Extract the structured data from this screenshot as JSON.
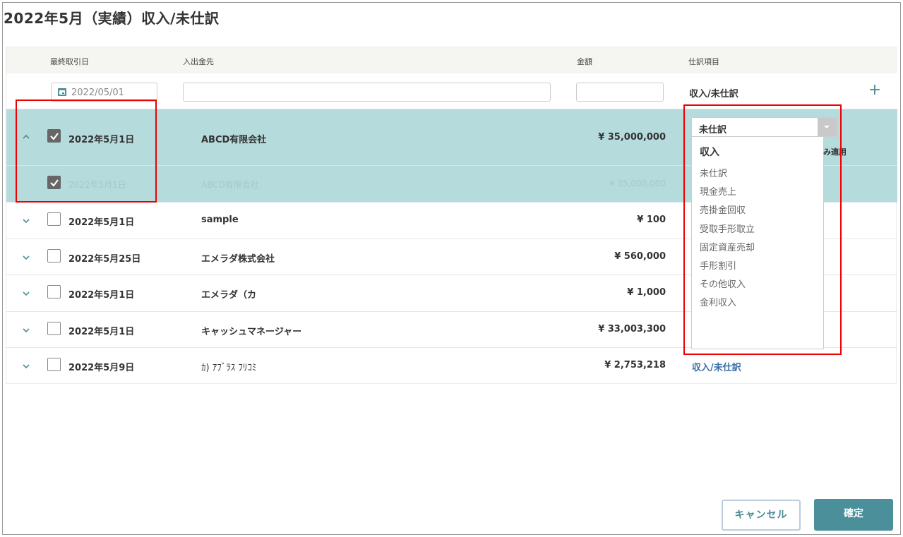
{
  "page": {
    "title": "2022年5月（実績）収入/未仕訳"
  },
  "table": {
    "headers": {
      "date": "最終取引日",
      "party": "入出金先",
      "amount": "金額",
      "category": "仕訳項目"
    },
    "filter": {
      "date_placeholder": "2022/05/01",
      "category_label": "収入/未仕訳"
    },
    "rows": [
      {
        "date": "2022年5月1日",
        "party": "ABCD有限会社",
        "amount": "¥ 35,000,000",
        "checked": true,
        "expanded": true
      },
      {
        "date": "2022年5月1日",
        "party": "ABCD有限会社",
        "amount": "¥ 35,000,000",
        "checked": true,
        "sub": true
      },
      {
        "date": "2022年5月1日",
        "party": "sample",
        "amount": "¥ 100",
        "checked": false
      },
      {
        "date": "2022年5月25日",
        "party": "エメラダ株式会社",
        "amount": "¥ 560,000",
        "checked": false
      },
      {
        "date": "2022年5月1日",
        "party": "エメラダ（カ",
        "amount": "¥ 1,000",
        "checked": false
      },
      {
        "date": "2022年5月1日",
        "party": "キャッシュマネージャー",
        "amount": "¥ 33,003,300",
        "checked": false
      },
      {
        "date": "2022年5月9日",
        "party": "ｶ) ｱﾌﾞﾗｽ ﾌﾘｺﾐ",
        "amount": "¥ 2,753,218",
        "checked": false,
        "category": "収入/未仕訳"
      }
    ]
  },
  "dropdown": {
    "selected": "未仕訳",
    "group_label": "収入",
    "options": [
      "未仕訳",
      "現金売上",
      "売掛金回収",
      "受取手形取立",
      "固定資産売却",
      "手形割引",
      "その他収入",
      "金利収入"
    ],
    "apply_partial": "み適用"
  },
  "footer": {
    "cancel_label": "キャンセル",
    "confirm_label": "確定"
  },
  "colors": {
    "selected_row": "#b5dbdc",
    "accent": "#4a8f99",
    "link": "#3a6ea8",
    "highlight": "#ee0000"
  },
  "icons": [
    "calendar-icon",
    "plus-icon",
    "chevron-up-icon",
    "chevron-down-icon",
    "check-icon",
    "dropdown-arrow-icon"
  ]
}
